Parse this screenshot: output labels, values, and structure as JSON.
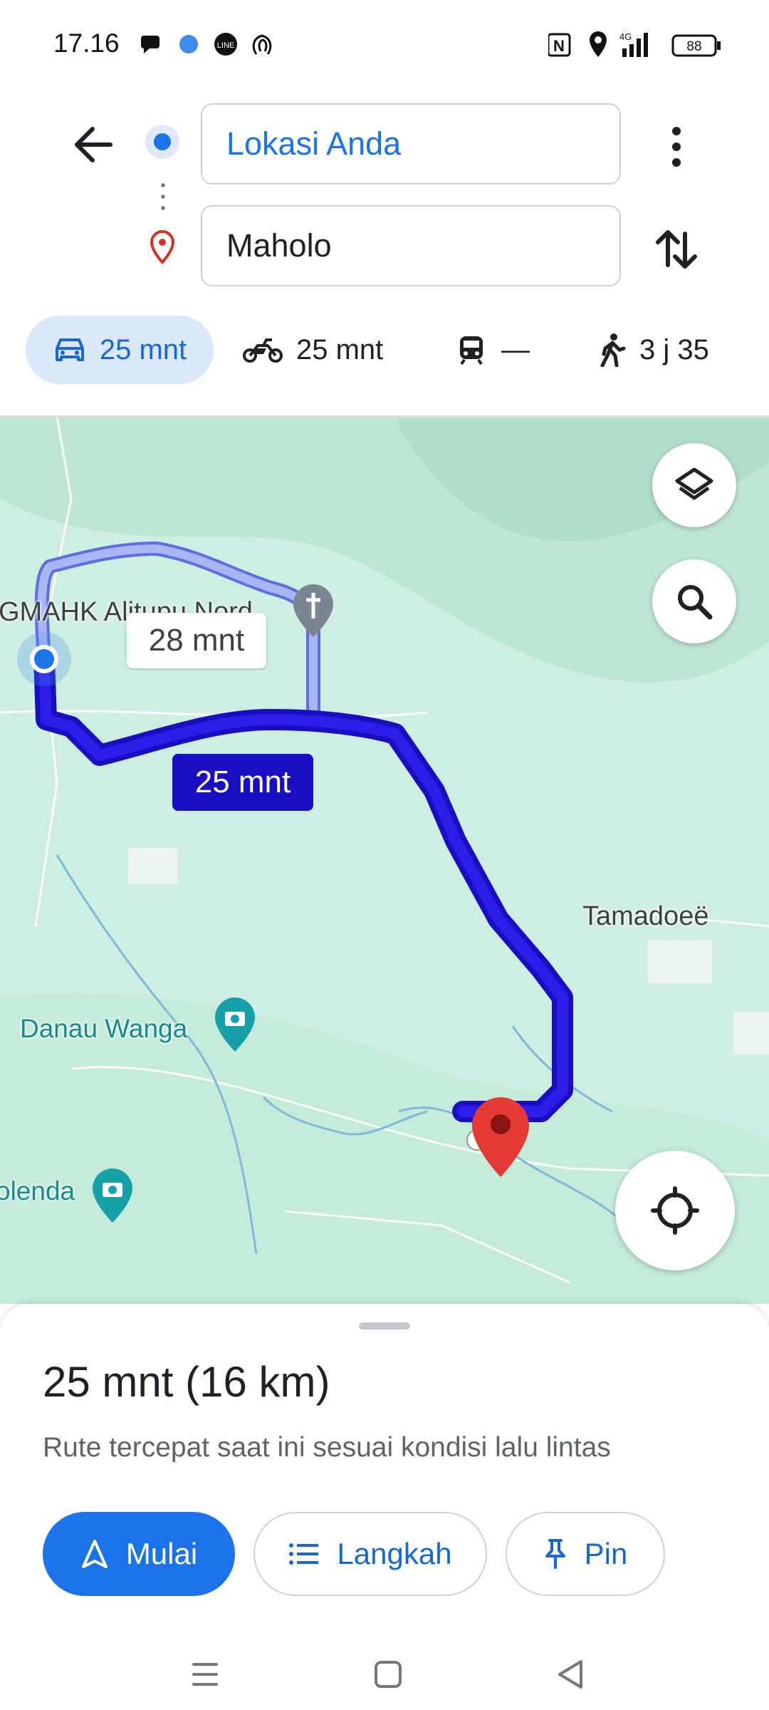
{
  "status_bar": {
    "time": "17.16",
    "battery": "88",
    "network": "4G"
  },
  "header": {
    "origin": "Lokasi Anda",
    "destination": "Maholo"
  },
  "modes": [
    {
      "icon": "car-icon",
      "label": "25 mnt",
      "active": true
    },
    {
      "icon": "motorcycle-icon",
      "label": "25 mnt",
      "active": false
    },
    {
      "icon": "train-icon",
      "label": "—",
      "active": false
    },
    {
      "icon": "walk-icon",
      "label": "3 j 35",
      "active": false
    }
  ],
  "map": {
    "labels": {
      "church": "GMAHK Alitupu Nord",
      "village": "Tamadoeë",
      "lake": "Danau Wanga",
      "place_left": "olenda"
    },
    "route_alt_time": "28 mnt",
    "route_main_time": "25 mnt"
  },
  "sheet": {
    "summary": "25 mnt (16 km)",
    "subtitle": "Rute tercepat saat ini sesuai kondisi lalu lintas",
    "start_label": "Mulai",
    "steps_label": "Langkah",
    "pin_label": "Pin"
  },
  "colors": {
    "accent": "#1a73e8",
    "route": "#1a0fc0",
    "route_alt": "#8f9ef0",
    "map_bg": "#cdeee0",
    "pin": "#e53935"
  }
}
